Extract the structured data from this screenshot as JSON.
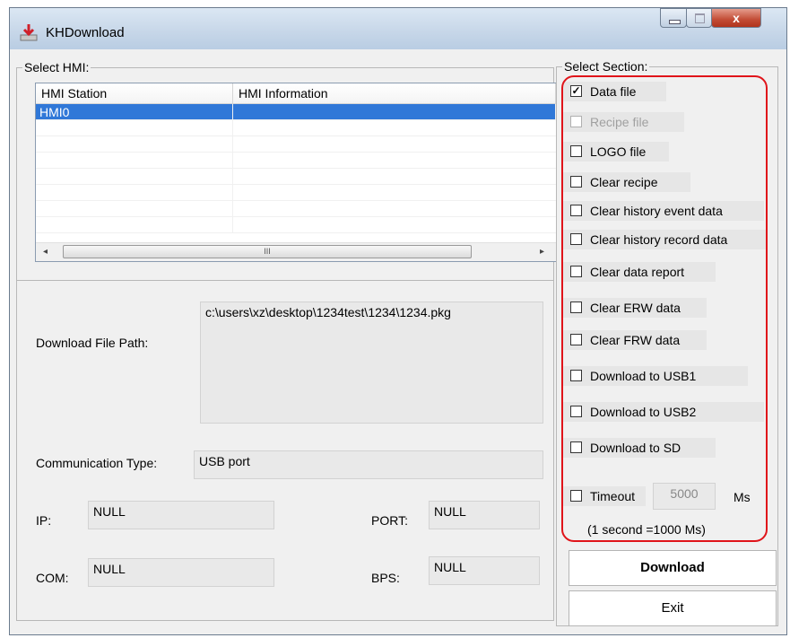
{
  "window": {
    "title": "KHDownload",
    "close_glyph": "x"
  },
  "hmi_group": {
    "legend": "Select HMI:",
    "columns": [
      "HMI Station",
      "HMI Information"
    ],
    "rows": [
      {
        "station": "HMI0",
        "info": "",
        "selected": true
      }
    ],
    "scroll_thumb_glyph": "III",
    "scroll_left_glyph": "◂",
    "scroll_right_glyph": "▸"
  },
  "info_group": {
    "download_path_label": "Download File Path:",
    "download_path_value": "c:\\users\\xz\\desktop\\1234test\\1234\\1234.pkg",
    "comm_type_label": "Communication Type:",
    "comm_type_value": "USB port",
    "ip_label": "IP:",
    "ip_value": "NULL",
    "port_label": "PORT:",
    "port_value": "NULL",
    "com_label": "COM:",
    "com_value": "NULL",
    "bps_label": "BPS:",
    "bps_value": "NULL"
  },
  "section_group": {
    "legend": "Select Section:",
    "options": [
      {
        "label": "Data file",
        "checked": true,
        "enabled": true
      },
      {
        "label": "Recipe file",
        "checked": false,
        "enabled": false
      },
      {
        "label": "LOGO file",
        "checked": false,
        "enabled": true
      },
      {
        "label": "Clear recipe",
        "checked": false,
        "enabled": true
      },
      {
        "label": "Clear history event data",
        "checked": false,
        "enabled": true
      },
      {
        "label": "Clear history record data",
        "checked": false,
        "enabled": true
      },
      {
        "label": "Clear data report",
        "checked": false,
        "enabled": true
      },
      {
        "label": "Clear ERW data",
        "checked": false,
        "enabled": true
      },
      {
        "label": "Clear FRW data",
        "checked": false,
        "enabled": true
      },
      {
        "label": "Download to USB1",
        "checked": false,
        "enabled": true
      },
      {
        "label": "Download to USB2",
        "checked": false,
        "enabled": true
      },
      {
        "label": "Download to SD",
        "checked": false,
        "enabled": true
      }
    ],
    "timeout_label": "Timeout",
    "timeout_value": "5000",
    "timeout_unit": "Ms",
    "timeout_note": "(1 second =1000 Ms)",
    "check_glyph": "✓"
  },
  "buttons": {
    "download": "Download",
    "exit": "Exit"
  },
  "colors": {
    "selection": "#3078d8",
    "highlight_border": "#e0141a",
    "close_button": "#c24b34"
  }
}
